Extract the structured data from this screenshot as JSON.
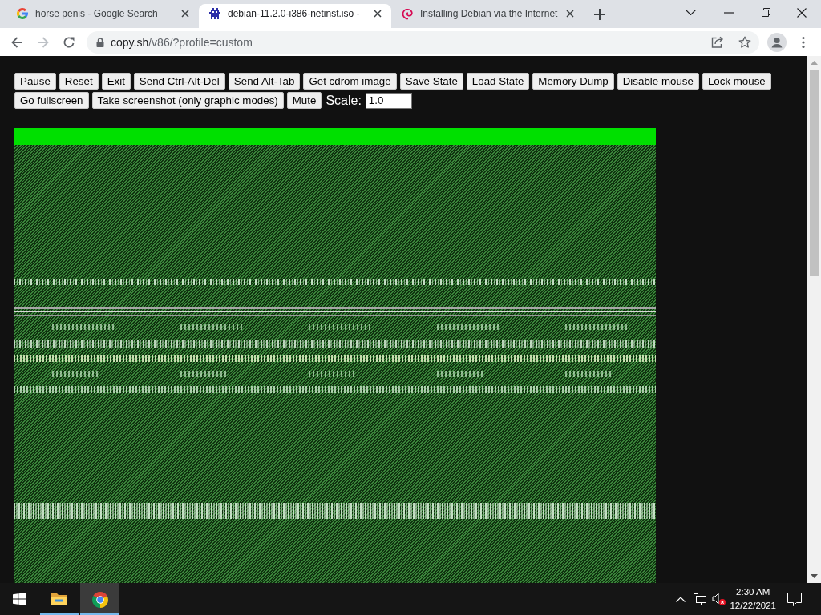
{
  "browser": {
    "tabs": [
      {
        "kind": "letter-g",
        "title": "horse penis - Google Search",
        "selected": false
      },
      {
        "kind": "pixel-creature",
        "title": "debian-11.2.0-i386-netinst.iso -",
        "selected": true
      },
      {
        "kind": "swirl",
        "title": "Installing Debian via the Internet",
        "selected": false
      }
    ]
  },
  "address_bar": {
    "host": "copy.sh",
    "path": "/v86/?profile=custom"
  },
  "page": {
    "control_rows": [
      {
        "items": [
          {
            "kind": "button",
            "label": "Pause"
          },
          {
            "kind": "button",
            "label": "Reset"
          },
          {
            "kind": "button",
            "label": "Exit"
          },
          {
            "kind": "button",
            "label": "Send Ctrl-Alt-Del"
          },
          {
            "kind": "button",
            "label": "Send Alt-Tab"
          },
          {
            "kind": "button",
            "label": "Get cdrom image"
          },
          {
            "kind": "button",
            "label": "Save State"
          },
          {
            "kind": "button",
            "label": "Load State"
          },
          {
            "kind": "button",
            "label": "Memory Dump"
          },
          {
            "kind": "button",
            "label": "Disable mouse"
          },
          {
            "kind": "button",
            "label": "Lock mouse"
          }
        ]
      },
      {
        "items": [
          {
            "kind": "button",
            "label": "Go fullscreen"
          },
          {
            "kind": "button",
            "label": "Take screenshot (only graphic modes)"
          },
          {
            "kind": "button",
            "label": "Mute"
          },
          {
            "kind": "label",
            "text": "Scale:"
          },
          {
            "kind": "field",
            "value": "1.0"
          }
        ]
      }
    ]
  },
  "taskbar": {
    "apps": [
      {
        "kind": "folder",
        "running": true,
        "selected": false
      },
      {
        "kind": "circle-logo",
        "running": true,
        "selected": true
      }
    ],
    "volume": {
      "muted": true
    },
    "clock": {
      "time": "2:30 AM",
      "date": "12/22/2021"
    }
  }
}
